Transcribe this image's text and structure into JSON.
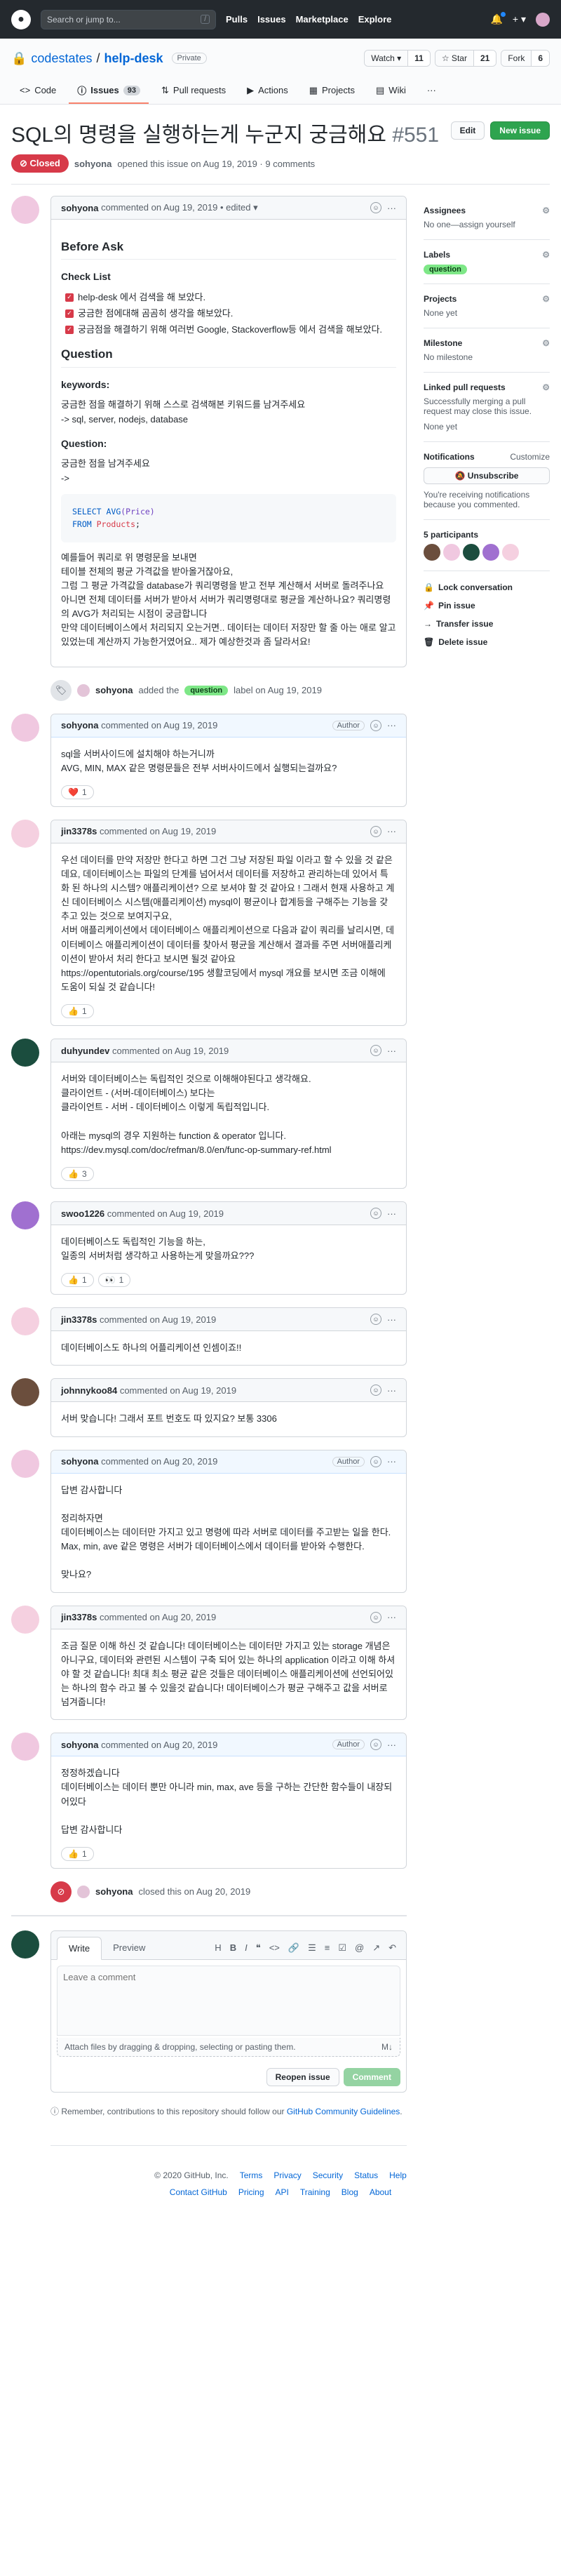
{
  "topbar": {
    "search_placeholder": "Search or jump to...",
    "search_shortcut": "/",
    "nav": [
      "Pulls",
      "Issues",
      "Marketplace",
      "Explore"
    ],
    "plus": "+ ▾"
  },
  "repo": {
    "owner": "codestates",
    "name": "help-desk",
    "visibility": "Private",
    "watch_label": "Watch ▾",
    "watch_count": "11",
    "star_label": "☆ Star",
    "star_count": "21",
    "fork_label": "Fork",
    "fork_count": "6"
  },
  "tabs": [
    {
      "icon": "<>",
      "label": "Code"
    },
    {
      "icon": "ⓘ",
      "label": "Issues",
      "count": "93"
    },
    {
      "icon": "⇅",
      "label": "Pull requests"
    },
    {
      "icon": "▶",
      "label": "Actions"
    },
    {
      "icon": "▦",
      "label": "Projects"
    },
    {
      "icon": "▤",
      "label": "Wiki"
    }
  ],
  "issue": {
    "title": "SQL의 명령을 실행하는게 누군지 궁금해요",
    "number": "#551",
    "edit": "Edit",
    "new_issue": "New issue",
    "state": "⊘ Closed",
    "meta_author": "sohyona",
    "meta_text": "opened this issue on Aug 19, 2019 · 9 comments"
  },
  "first": {
    "author": "sohyona",
    "time": "commented on Aug 19, 2019 • edited ▾",
    "before_ask": "Before Ask",
    "checklist": "Check List",
    "checks": [
      "help-desk 에서 검색을 해 보았다.",
      "궁금한 점에대해 곰곰히 생각을 해보았다.",
      "궁금점을 해결하기 위해 여러번 Google, Stackoverflow등 에서 검색을 해보았다."
    ],
    "question": "Question",
    "keywords": "keywords:",
    "kw1": "궁금한 점을 해결하기 위해 스스로 검색해본 키워드를 남겨주세요",
    "kw2": "-> sql, server, nodejs, database",
    "question2": "Question:",
    "q1": "궁금한 점을 남겨주세요",
    "q2": "->",
    "code1a": "SELECT ",
    "code1b": "AVG",
    "code1c": "(Price)",
    "code2a": "FROM ",
    "code2b": "Products",
    "code2c": ";",
    "body": "예를들어 쿼리로 위 명령문을 보내면\n테이블 전체의 평균 가격값을 받아올거잖아요,\n그럼 그 평균 가격값을 database가 쿼리명령을 받고 전부 계산해서 서버로 돌려주나요\n아니면 전체 데이터를 서버가 받아서 서버가 쿼리명령대로 평균을 계산하나요? 쿼리명령의 AVG가 처리되는 시점이 궁금합니다\n만약 데이터베이스에서 처리되지 오는거면.. 데이터는 데이터 저장만 할 줄 아는 애로 알고있었는데 계산까지 가능한거였어요.. 제가 예상한것과 좀 달라서요!"
  },
  "labelevent": {
    "author": "sohyona",
    "pre": "added the",
    "label": "question",
    "post": "label on Aug 19, 2019"
  },
  "comments": [
    {
      "author": "sohyona",
      "time": "commented on Aug 19, 2019",
      "badge": "Author",
      "body": "sql을 서버사이드에 설치해야 하는거니까\nAVG, MIN, MAX 같은 명령문들은 전부 서버사이드에서 실행되는걸까요?",
      "reactions": [
        {
          "e": "❤️",
          "n": "1"
        }
      ]
    },
    {
      "author": "jin3378s",
      "time": "commented on Aug 19, 2019",
      "badge": "",
      "body": "우선 데이터를 만약 저장만 한다고 하면 그건 그냥 저장된 파일 이라고 할 수 있을 것 같은데요, 데이터베이스는 파일의 단계를 넘어서서 데이터를 저장하고 관리하는데 있어서 특화 된 하나의 시스템? 애플리케이션? 으로 보셔야 할 것 같아요 ! 그래서 현재 사용하고 계신 데이터베이스 시스템(애플리케이션) mysql이 평균이나 합계등을 구해주는 기능을 갖추고 있는 것으로 보여지구요,\n서버 애플리케이션에서 데이터베이스 애플리케이션으로 다음과 같이 쿼리를 날리시면, 데이터베이스 애플리케이션이 데이터를 찾아서 평균을 계산해서 결과를 주면 서버애플리케이션이 받아서 처리 한다고 보시면 될것 같아요\nhttps://opentutorials.org/course/195 생활코딩에서 mysql 개요를 보시면 조금 이해에 도움이 되실 것 같습니다!",
      "reactions": [
        {
          "e": "👍",
          "n": "1"
        }
      ]
    },
    {
      "author": "duhyundev",
      "time": "commented on Aug 19, 2019",
      "badge": "",
      "body": "서버와 데이터베이스는 독립적인 것으로 이해해야된다고 생각해요.\n클라이언트 - (서버-데이터베이스) 보다는\n클라이언트 - 서버 - 데이터베이스 이렇게 독립적입니다.\n\n아래는 mysql의 경우 지원하는 function & operator 입니다.\nhttps://dev.mysql.com/doc/refman/8.0/en/func-op-summary-ref.html",
      "reactions": [
        {
          "e": "👍",
          "n": "3"
        }
      ]
    },
    {
      "author": "swoo1226",
      "time": "commented on Aug 19, 2019",
      "badge": "",
      "body": "데이터베이스도 독립적인 기능을 하는,\n일종의 서버처럼 생각하고 사용하는게 맞을까요???",
      "reactions": [
        {
          "e": "👍",
          "n": "1"
        },
        {
          "e": "👀",
          "n": "1"
        }
      ]
    },
    {
      "author": "jin3378s",
      "time": "commented on Aug 19, 2019",
      "badge": "",
      "body": "데이터베이스도 하나의 어플리케이션 인셈이죠!!",
      "reactions": []
    },
    {
      "author": "johnnykoo84",
      "time": "commented on Aug 19, 2019",
      "badge": "",
      "body": "서버 맞습니다! 그래서 포트 번호도 따 있지요? 보통 3306",
      "reactions": []
    },
    {
      "author": "sohyona",
      "time": "commented on Aug 20, 2019",
      "badge": "Author",
      "body": "답변 감사합니다\n\n정리하자면\n데이터베이스는 데이터만 가지고 있고 명령에 따라 서버로 데이터를 주고받는 일을 한다.\nMax, min, ave 같은 명령은 서버가 데이터베이스에서 데이터를 받아와 수행한다.\n\n맞나요?",
      "reactions": []
    },
    {
      "author": "jin3378s",
      "time": "commented on Aug 20, 2019",
      "badge": "",
      "body": "조금 질문 이해 하신 것 같습니다! 데이터베이스는 데이터만 가지고 있는 storage 개념은 아니구요, 데이터와 관련된 시스템이 구축 되어 있는 하나의 application 이라고 이해 하셔야 할 것 같습니다! 최대 최소 평균 같은 것들은 데이터베이스 애플리케이션에 선언되어있는 하나의 함수 라고 볼 수 있을것 같습니다! 데이터베이스가 평균 구해주고 값을 서버로 넘겨줍니다!",
      "reactions": []
    },
    {
      "author": "sohyona",
      "time": "commented on Aug 20, 2019",
      "badge": "Author",
      "body": "정정하겠습니다\n데이터베이스는 데이터 뿐만 아니라 min, max, ave 등을 구하는 간단한 함수들이 내장되어있다\n\n답변 감사합니다",
      "reactions": [
        {
          "e": "👍",
          "n": "1"
        }
      ]
    }
  ],
  "closeevent": {
    "author": "sohyona",
    "text": "closed this on Aug 20, 2019"
  },
  "newcomment": {
    "write": "Write",
    "preview": "Preview",
    "placeholder": "Leave a comment",
    "attach": "Attach files by dragging & dropping, selecting or pasting them.",
    "md": "M↓",
    "reopen": "Reopen issue",
    "comment": "Comment",
    "tip_pre": "Remember, contributions to this repository should follow our",
    "tip_link": "GitHub Community Guidelines",
    "tip_post": "."
  },
  "sidebar": {
    "assignees": "Assignees",
    "assignees_val": "No one—assign yourself",
    "labels": "Labels",
    "label_val": "question",
    "projects": "Projects",
    "projects_val": "None yet",
    "milestone": "Milestone",
    "milestone_val": "No milestone",
    "linked": "Linked pull requests",
    "linked_desc": "Successfully merging a pull request may close this issue.",
    "linked_val": "None yet",
    "notifications": "Notifications",
    "customize": "Customize",
    "unsubscribe": "🔕 Unsubscribe",
    "notif_desc": "You're receiving notifications because you commented.",
    "participants": "5 participants",
    "lock": "Lock conversation",
    "pin": "Pin issue",
    "transfer": "Transfer issue",
    "delete": "Delete issue"
  },
  "footer": {
    "copy": "© 2020 GitHub, Inc.",
    "row1": [
      "Terms",
      "Privacy",
      "Security",
      "Status",
      "Help"
    ],
    "row2": [
      "Contact GitHub",
      "Pricing",
      "API",
      "Training",
      "Blog",
      "About"
    ]
  },
  "colors": {
    "closed": "#d73a49",
    "label": "#7ee787",
    "accent": "#0366d6"
  }
}
